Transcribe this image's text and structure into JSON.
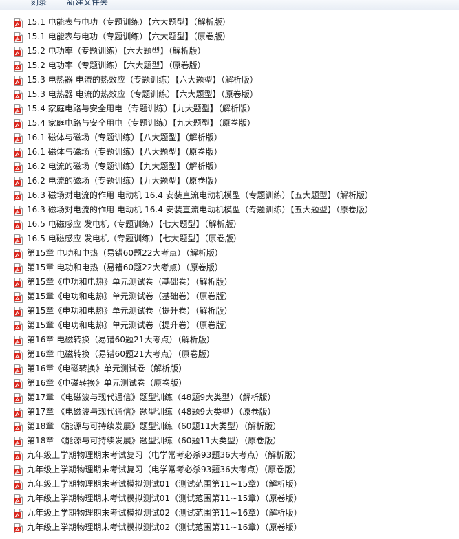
{
  "toolbar": {
    "share_label": "刻录",
    "new_folder_label": "新建文件夹"
  },
  "file_icon": "pdf-icon",
  "colors": {
    "pdf_red": "#d9261c",
    "text": "#1a1a1a"
  },
  "files": [
    "15.1 电能表与电功（专题训练）【六大题型】（解析版）",
    "15.1 电能表与电功（专题训练）【六大题型】（原卷版）",
    "15.2 电功率（专题训练）【六大题型】（解析版）",
    "15.2 电功率（专题训练）【六大题型】（原卷版）",
    "15.3 电热器 电流的热效应（专题训练）【六大题型】（解析版）",
    "15.3 电热器 电流的热效应（专题训练）【六大题型】（原卷版）",
    "15.4 家庭电路与安全用电（专题训练）【九大题型】（解析版）",
    "15.4 家庭电路与安全用电（专题训练）【九大题型】（原卷版）",
    "16.1 磁体与磁场（专题训练）【八大题型】（解析版）",
    "16.1 磁体与磁场（专题训练）【八大题型】（原卷版）",
    "16.2 电流的磁场（专题训练）【九大题型】（解析版）",
    "16.2 电流的磁场（专题训练）【九大题型】（原卷版）",
    "16.3 磁场对电流的作用 电动机 16.4 安装直流电动机模型（专题训练）【五大题型】（解析版）",
    "16.3 磁场对电流的作用 电动机 16.4 安装直流电动机模型（专题训练）【五大题型】（原卷版）",
    "16.5 电磁感应 发电机（专题训练）【七大题型】（解析版）",
    "16.5 电磁感应 发电机（专题训练）【七大题型】（原卷版）",
    "第15章 电功和电热（易错60题22大考点）（解析版）",
    "第15章 电功和电热（易错60题22大考点）（原卷版）",
    "第15章《电功和电热》单元测试卷（基础卷）（解析版）",
    "第15章《电功和电热》单元测试卷（基础卷）（原卷版）",
    "第15章《电功和电热》单元测试卷（提升卷）（解析版）",
    "第15章《电功和电热》单元测试卷（提升卷）（原卷版）",
    "第16章 电磁转换（易错60题21大考点）（解析版）",
    "第16章 电磁转换（易错60题21大考点）（原卷版）",
    "第16章《电磁转换》单元测试卷（解析版）",
    "第16章《电磁转换》单元测试卷（原卷版）",
    "第17章 《电磁波与现代通信》题型训练（48题9大类型）（解析版）",
    "第17章 《电磁波与现代通信》题型训练（48题9大类型）（原卷版）",
    "第18章 《能源与可持续发展》题型训练（60题11大类型）（解析版）",
    "第18章 《能源与可持续发展》题型训练（60题11大类型）（原卷版）",
    "九年级上学期物理期末考试复习（电学常考必杀93题36大考点）（解析版）",
    "九年级上学期物理期末考试复习（电学常考必杀93题36大考点）（原卷版）",
    "九年级上学期物理期末考试模拟测试01（测试范围第11~15章）（解析版）",
    "九年级上学期物理期末考试模拟测试01（测试范围第11~15章）（原卷版）",
    "九年级上学期物理期末考试模拟测试02（测试范围第11~16章）（解析版）",
    "九年级上学期物理期末考试模拟测试02（测试范围第11~16章）（原卷版）"
  ]
}
